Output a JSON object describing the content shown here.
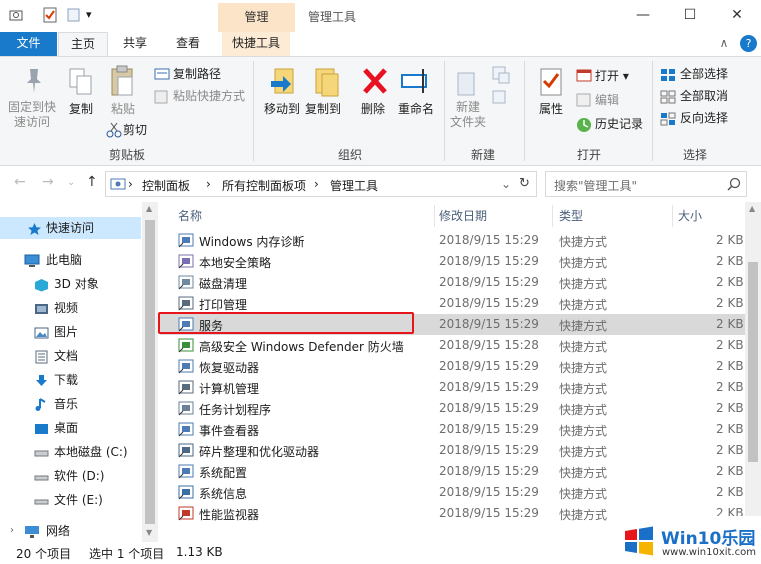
{
  "window": {
    "title": "管理工具",
    "context_tab_header": "管理",
    "minimize": "—",
    "maximize": "☐",
    "close": "✕",
    "qa_dropdown": "▾"
  },
  "tabs": {
    "file": "文件",
    "home": "主页",
    "share": "共享",
    "view": "查看",
    "tools": "快捷工具",
    "collapse": "∧",
    "help": "?"
  },
  "ribbon": {
    "clipboard": {
      "label": "剪贴板",
      "pin_line1": "固定到快",
      "pin_line2": "速访问",
      "copy": "复制",
      "paste": "粘贴",
      "copy_path": "复制路径",
      "paste_shortcut": "粘贴快捷方式",
      "cut": "剪切"
    },
    "organize": {
      "label": "组织",
      "move_to": "移动到",
      "copy_to": "复制到",
      "delete": "删除",
      "rename": "重命名"
    },
    "new": {
      "label": "新建",
      "new_folder_line1": "新建",
      "new_folder_line2": "文件夹"
    },
    "open": {
      "label": "打开",
      "properties": "属性",
      "open": "打开",
      "edit": "编辑",
      "history": "历史记录"
    },
    "select": {
      "label": "选择",
      "select_all": "全部选择",
      "select_none": "全部取消",
      "invert": "反向选择"
    }
  },
  "address": {
    "crumbs": [
      "控制面板",
      "所有控制面板项",
      "管理工具"
    ],
    "separator": "›",
    "search_placeholder": "搜索\"管理工具\"",
    "refresh": "↻",
    "dropdown": "⌄"
  },
  "nav": {
    "items": [
      {
        "label": "快速访问",
        "icon": "star-icon"
      },
      {
        "label": "此电脑",
        "icon": "computer-icon"
      },
      {
        "label": "3D 对象",
        "icon": "cube-icon"
      },
      {
        "label": "视频",
        "icon": "video-icon"
      },
      {
        "label": "图片",
        "icon": "picture-icon"
      },
      {
        "label": "文档",
        "icon": "document-icon"
      },
      {
        "label": "下载",
        "icon": "download-icon"
      },
      {
        "label": "音乐",
        "icon": "music-icon"
      },
      {
        "label": "桌面",
        "icon": "desktop-icon"
      },
      {
        "label": "本地磁盘 (C:)",
        "icon": "drive-icon"
      },
      {
        "label": "软件 (D:)",
        "icon": "drive-icon"
      },
      {
        "label": "文件 (E:)",
        "icon": "drive-icon"
      },
      {
        "label": "网络",
        "icon": "network-icon"
      }
    ]
  },
  "list": {
    "columns": {
      "name": "名称",
      "date": "修改日期",
      "type": "类型",
      "size": "大小"
    },
    "rows": [
      {
        "name": "Windows 内存诊断",
        "date": "2018/9/15 15:29",
        "type": "快捷方式",
        "size": "2 KB"
      },
      {
        "name": "本地安全策略",
        "date": "2018/9/15 15:29",
        "type": "快捷方式",
        "size": "2 KB"
      },
      {
        "name": "磁盘清理",
        "date": "2018/9/15 15:29",
        "type": "快捷方式",
        "size": "2 KB"
      },
      {
        "name": "打印管理",
        "date": "2018/9/15 15:29",
        "type": "快捷方式",
        "size": "2 KB"
      },
      {
        "name": "服务",
        "date": "2018/9/15 15:29",
        "type": "快捷方式",
        "size": "2 KB"
      },
      {
        "name": "高级安全 Windows Defender 防火墙",
        "date": "2018/9/15 15:28",
        "type": "快捷方式",
        "size": "2 KB"
      },
      {
        "name": "恢复驱动器",
        "date": "2018/9/15 15:29",
        "type": "快捷方式",
        "size": "2 KB"
      },
      {
        "name": "计算机管理",
        "date": "2018/9/15 15:29",
        "type": "快捷方式",
        "size": "2 KB"
      },
      {
        "name": "任务计划程序",
        "date": "2018/9/15 15:29",
        "type": "快捷方式",
        "size": "2 KB"
      },
      {
        "name": "事件查看器",
        "date": "2018/9/15 15:29",
        "type": "快捷方式",
        "size": "2 KB"
      },
      {
        "name": "碎片整理和优化驱动器",
        "date": "2018/9/15 15:29",
        "type": "快捷方式",
        "size": "2 KB"
      },
      {
        "name": "系统配置",
        "date": "2018/9/15 15:29",
        "type": "快捷方式",
        "size": "2 KB"
      },
      {
        "name": "系统信息",
        "date": "2018/9/15 15:29",
        "type": "快捷方式",
        "size": "2 KB"
      },
      {
        "name": "性能监视器",
        "date": "2018/9/15 15:29",
        "type": "快捷方式",
        "size": "2 KB"
      }
    ]
  },
  "status": {
    "count": "20 个项目",
    "selected": "选中 1 个项目",
    "size": "1.13 KB"
  },
  "watermark": {
    "title": "Win10乐园",
    "url": "www.win10xit.com"
  },
  "colors": {
    "accent": "#1979ca",
    "context_tab": "#fce4c8",
    "selection": "#d9d9d9",
    "highlight_box": "#e8141c"
  }
}
